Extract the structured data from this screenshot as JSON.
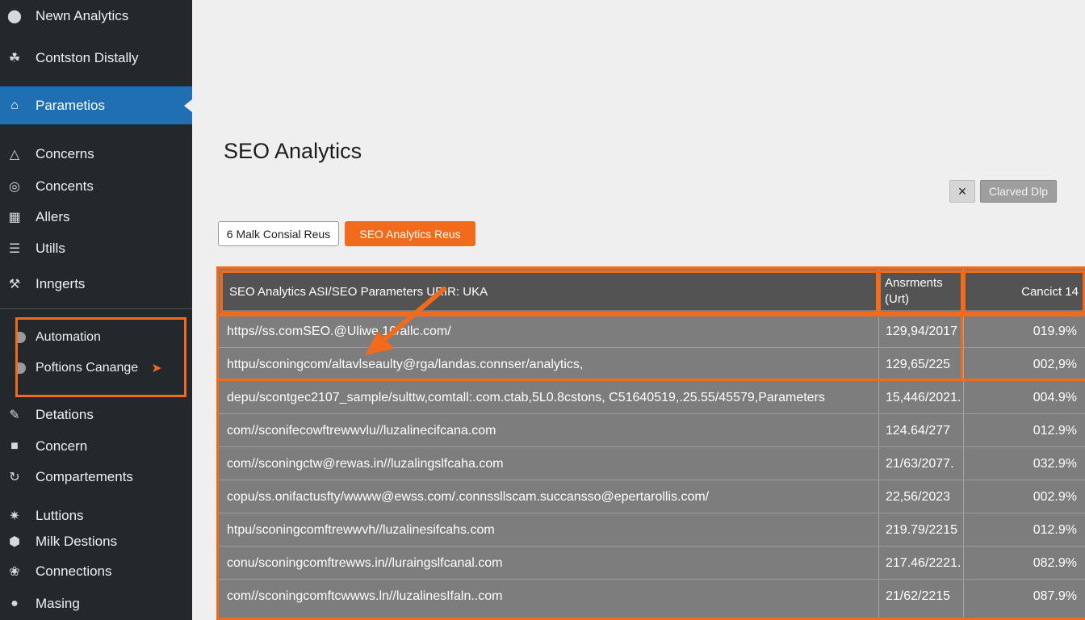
{
  "sidebar": {
    "items": [
      {
        "label": "Newn Analytics",
        "icon": "palette-icon"
      },
      {
        "label": "Contston Distally",
        "icon": "plugin-icon"
      },
      {
        "label": "Parametios",
        "icon": "home-icon",
        "active": true
      },
      {
        "label": "Concerns",
        "icon": "triangle-icon"
      },
      {
        "label": "Concents",
        "icon": "globe-icon"
      },
      {
        "label": "Allers",
        "icon": "grid-icon"
      },
      {
        "label": "Utills",
        "icon": "list-icon"
      },
      {
        "label": "Inngerts",
        "icon": "wrench-icon"
      },
      {
        "label": "Detations",
        "icon": "edit-icon"
      },
      {
        "label": "Concern",
        "icon": "briefcase-icon"
      },
      {
        "label": "Compartements",
        "icon": "refresh-icon"
      },
      {
        "label": "Luttions",
        "icon": "settings-icon"
      },
      {
        "label": "Milk Destions",
        "icon": "shield-icon"
      },
      {
        "label": "Connections",
        "icon": "link-icon"
      },
      {
        "label": "Masing",
        "icon": "circle-icon"
      }
    ],
    "submenu": [
      {
        "label": "Automation"
      },
      {
        "label": "Poftions Canange"
      }
    ]
  },
  "main": {
    "title": "SEO Analytics",
    "close_label": "×",
    "dim_button_label": "Clarved Dlp",
    "tabs": [
      {
        "label": "6 Malk Consial Reus"
      },
      {
        "label": "SEO Analytics Reus"
      }
    ]
  },
  "table": {
    "headers": {
      "url": "SEO Analytics ASI/SEO Parameters URIR: UKA",
      "assignments": "Ansrments\n(Urt)",
      "cancict": "Cancict 14"
    },
    "rows": [
      {
        "url": "https//ss.comSEO.@Uliwe 10/allc.com/",
        "assign": "129,94/2017",
        "cancict": "019.9%"
      },
      {
        "url": "httpu/sconingcom/altavlseaulty@rga/landas.connser/analytics,",
        "assign": "129,65/225",
        "cancict": "002,9%"
      },
      {
        "url": "depu/scontgec2107_sample/sulttw,comtall:.com.ctab,5L0.8cstons, C51640519,.25.55/45579,Parameters",
        "assign": "15,446/2021.",
        "cancict": "004.9%"
      },
      {
        "url": "com//sconifecowftrewwvlu//luzalinecifcana.com",
        "assign": "124.64/277",
        "cancict": "012.9%"
      },
      {
        "url": "com//sconingctw@rewas.in//luzalingslfcaha.com",
        "assign": "21/63/2077.",
        "cancict": "032.9%"
      },
      {
        "url": "copu/ss.onifactusfty/wwww@ewss.com/.connssllscam.succansso@epertarollis.com/",
        "assign": "22,56/2023",
        "cancict": "002.9%"
      },
      {
        "url": "htpu/sconingcomftrewwvh//luzalinesifcahs.com",
        "assign": "219.79/2215",
        "cancict": "012.9%"
      },
      {
        "url": "conu/sconingcomftrewws.in//luraingslfcanal.com",
        "assign": "217.46/2221.",
        "cancict": "082.9%"
      },
      {
        "url": "com//sconingcomftcwwws.ln//luzalinesIfaln..com",
        "assign": "21/62/2215",
        "cancict": "087.9%"
      }
    ]
  },
  "colors": {
    "sidebar_bg": "#23282d",
    "active_bg": "#1f6fb2",
    "accent_orange": "#f26a1b",
    "table_bg": "#7d7d7d",
    "header_bg": "#535353"
  }
}
